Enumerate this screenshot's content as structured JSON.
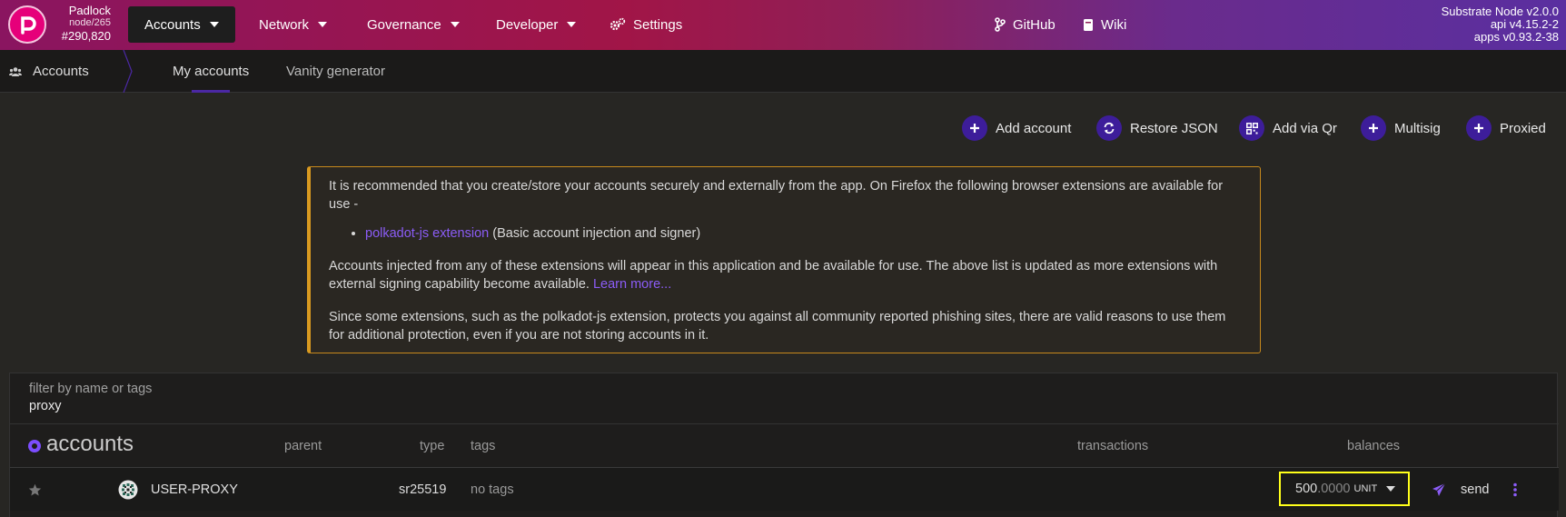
{
  "chain": {
    "name": "Padlock",
    "version": "node/265",
    "block": "#290,820"
  },
  "menu": {
    "accounts": "Accounts",
    "network": "Network",
    "governance": "Governance",
    "developer": "Developer",
    "settings": "Settings",
    "github": "GitHub",
    "wiki": "Wiki"
  },
  "node_info": {
    "line1": "Substrate Node v2.0.0",
    "line2": "api v4.15.2-2",
    "line3": "apps v0.93.2-38"
  },
  "subnav": {
    "section": "Accounts",
    "tabs": [
      "My accounts",
      "Vanity generator"
    ]
  },
  "actions": {
    "add_account": "Add account",
    "restore_json": "Restore JSON",
    "add_via_qr": "Add via Qr",
    "multisig": "Multisig",
    "proxied": "Proxied"
  },
  "info": {
    "p1": "It is recommended that you create/store your accounts securely and externally from the app. On Firefox the following browser extensions are available for use -",
    "ext_link": "polkadot-js extension",
    "ext_desc": " (Basic account injection and signer)",
    "p2": "Accounts injected from any of these extensions will appear in this application and be available for use. The above list is updated as more extensions with external signing capability become available. ",
    "learn_more": "Learn more...",
    "p3": "Since some extensions, such as the polkadot-js extension, protects you against all community reported phishing sites, there are valid reasons to use them for additional protection, even if you are not storing accounts in it."
  },
  "filter": {
    "label": "filter by name or tags",
    "value": "proxy"
  },
  "table": {
    "title": "accounts",
    "headers": {
      "parent": "parent",
      "type": "type",
      "tags": "tags",
      "transactions": "transactions",
      "balances": "balances"
    },
    "rows": [
      {
        "name": "USER-PROXY",
        "type": "sr25519",
        "tags": "no tags",
        "balance_int": "500",
        "balance_dec": ".0000",
        "unit": "UNIT",
        "send": "send"
      }
    ]
  }
}
